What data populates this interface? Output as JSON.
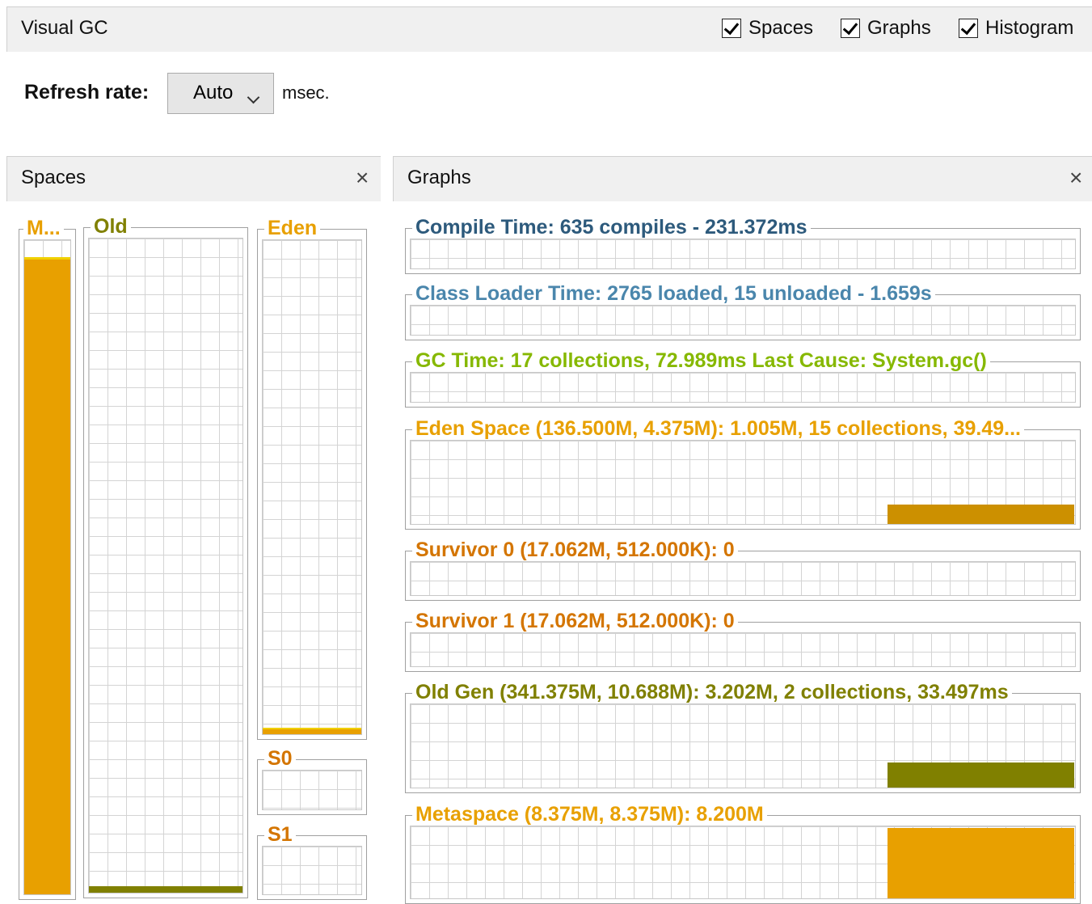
{
  "window": {
    "title": "Visual GC",
    "options": [
      {
        "label": "Spaces",
        "checked": true
      },
      {
        "label": "Graphs",
        "checked": true
      },
      {
        "label": "Histogram",
        "checked": true
      }
    ]
  },
  "refresh": {
    "label": "Refresh rate:",
    "value": "Auto",
    "unit": "msec."
  },
  "colors": {
    "compile": "#2d5a7c",
    "classloader": "#4a86ac",
    "gc": "#86b800",
    "eden": "#e8a000",
    "survivor": "#d47500",
    "oldgen": "#808000",
    "metaspace": "#e8a000"
  },
  "spaces_panel": {
    "title": "Spaces",
    "close": "×",
    "meta": {
      "label": "M...",
      "fill_fraction": 0.97
    },
    "old": {
      "label": "Old",
      "fill_fraction": 0.01
    },
    "eden": {
      "label": "Eden",
      "fill_fraction": 0.01
    },
    "s0": {
      "label": "S0"
    },
    "s1": {
      "label": "S1"
    }
  },
  "graphs_panel": {
    "title": "Graphs",
    "close": "×",
    "graphs": [
      {
        "key": "compile",
        "label": "Compile Time: 635 compiles - 231.372ms"
      },
      {
        "key": "classloader",
        "label": "Class Loader Time: 2765 loaded, 15 unloaded - 1.659s"
      },
      {
        "key": "gc",
        "label": "GC Time: 17 collections, 72.989ms Last Cause: System.gc()"
      },
      {
        "key": "eden",
        "label": "Eden Space (136.500M, 4.375M): 1.005M, 15 collections, 39.49...",
        "recent_fill_fraction": 0.23
      },
      {
        "key": "survivor0",
        "label": "Survivor 0 (17.062M, 512.000K): 0"
      },
      {
        "key": "survivor1",
        "label": "Survivor 1 (17.062M, 512.000K): 0"
      },
      {
        "key": "oldgen",
        "label": "Old Gen (341.375M, 10.688M): 3.202M, 2 collections, 33.497ms",
        "recent_fill_fraction": 0.3
      },
      {
        "key": "metaspace",
        "label": "Metaspace (8.375M, 8.375M): 8.200M",
        "recent_fill_fraction": 0.98
      }
    ]
  }
}
